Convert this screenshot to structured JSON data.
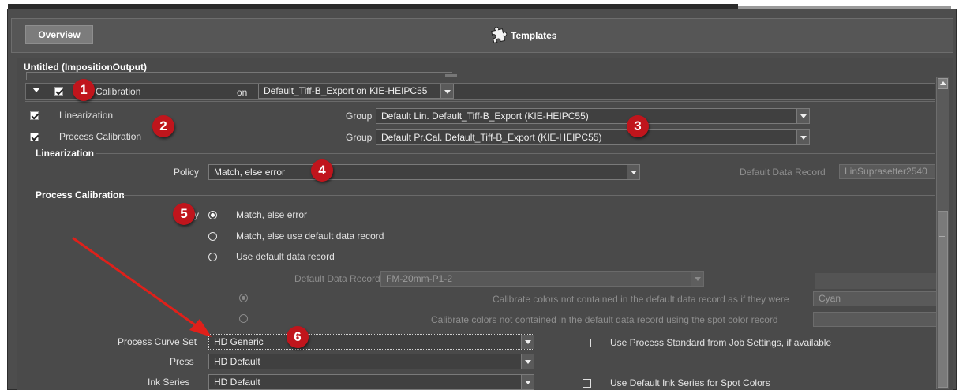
{
  "header": {
    "overview_label": "Overview",
    "templates_label": "Templates",
    "templates_icon": "puzzle-icon"
  },
  "panel": {
    "title": "Untitled (ImpositionOutput)"
  },
  "calibration_row": {
    "label": "Calibration",
    "on_label": "on",
    "target": "Default_Tiff-B_Export on KIE-HEIPC55",
    "checked": true
  },
  "linearization_row": {
    "label": "Linearization",
    "checked": true,
    "group_label": "Group",
    "group_value": "Default Lin. Default_Tiff-B_Export (KIE-HEIPC55)"
  },
  "process_calibration_row": {
    "label": "Process Calibration",
    "checked": true,
    "group_label": "Group",
    "group_value": "Default Pr.Cal. Default_Tiff-B_Export (KIE-HEIPC55)"
  },
  "linearization_section": {
    "title": "Linearization",
    "policy_label": "Policy",
    "policy_value": "Match, else error",
    "default_record_label": "Default Data Record",
    "default_record_value": "LinSuprasetter2540"
  },
  "process_section": {
    "title": "Process Calibration",
    "policy_label": "Policy",
    "options": [
      {
        "label": "Match, else error",
        "selected": true
      },
      {
        "label": "Match, else use default data record",
        "selected": false
      },
      {
        "label": "Use default data record",
        "selected": false
      }
    ],
    "default_record_label": "Default Data Record",
    "default_record_value": "FM-20mm-P1-2",
    "calibrate_as_label": "Calibrate colors not contained in the default data record as if they were",
    "calibrate_as_value": "Cyan",
    "calibrate_spot_label": "Calibrate colors not contained in the default data record using the spot color record",
    "calibrate_spot_value": "",
    "curve_set_label": "Process Curve Set",
    "curve_set_value": "HD Generic",
    "press_label": "Press",
    "press_value": "HD Default",
    "ink_label": "Ink Series",
    "ink_value": "HD Default",
    "use_standard_label": "Use Process Standard from Job Settings, if available",
    "use_standard_checked": false,
    "use_ink_label": "Use Default Ink Series for Spot Colors",
    "use_ink_checked": false
  },
  "badges": [
    "1",
    "2",
    "3",
    "4",
    "5",
    "6"
  ],
  "colors": {
    "badge": "#c0151c",
    "arrow": "#e0201a",
    "panel_bg": "#4a4a4a"
  }
}
